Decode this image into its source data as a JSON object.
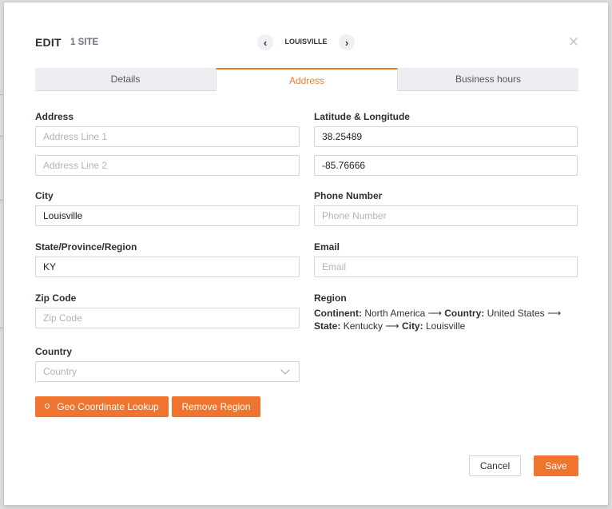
{
  "backdrop": {
    "caption": "…"
  },
  "header": {
    "title": "EDIT",
    "count": "1 SITE",
    "nav_label": "LOUISVILLE",
    "prev_icon": "chevron-left-icon",
    "next_icon": "chevron-right-icon",
    "close_icon": "close-icon"
  },
  "tabs": [
    {
      "label": "Details",
      "active": false
    },
    {
      "label": "Address",
      "active": true
    },
    {
      "label": "Business hours",
      "active": false
    }
  ],
  "form": {
    "address": {
      "label": "Address",
      "line1_placeholder": "Address Line 1",
      "line1_value": "",
      "line2_placeholder": "Address Line 2",
      "line2_value": ""
    },
    "city": {
      "label": "City",
      "value": "Louisville"
    },
    "state": {
      "label": "State/Province/Region",
      "value": "KY"
    },
    "zip": {
      "label": "Zip Code",
      "placeholder": "Zip Code",
      "value": ""
    },
    "country": {
      "label": "Country",
      "placeholder": "Country"
    },
    "latlng": {
      "label": "Latitude & Longitude",
      "latitude": "38.25489",
      "longitude": "-85.76666"
    },
    "phone": {
      "label": "Phone Number",
      "placeholder": "Phone Number",
      "value": ""
    },
    "email": {
      "label": "Email",
      "placeholder": "Email",
      "value": ""
    },
    "region": {
      "label": "Region",
      "continent_key": "Continent:",
      "continent": "North America",
      "country_key": "Country:",
      "country": "United States",
      "state_key": "State:",
      "state": "Kentucky",
      "city_key": "City:",
      "city": "Louisville",
      "arrow": "⟶"
    }
  },
  "buttons": {
    "geo_lookup": "Geo Coordinate Lookup",
    "remove_region": "Remove Region",
    "cancel": "Cancel",
    "save": "Save"
  },
  "colors": {
    "accent": "#ee7430",
    "tab_active": "#f07a33"
  }
}
